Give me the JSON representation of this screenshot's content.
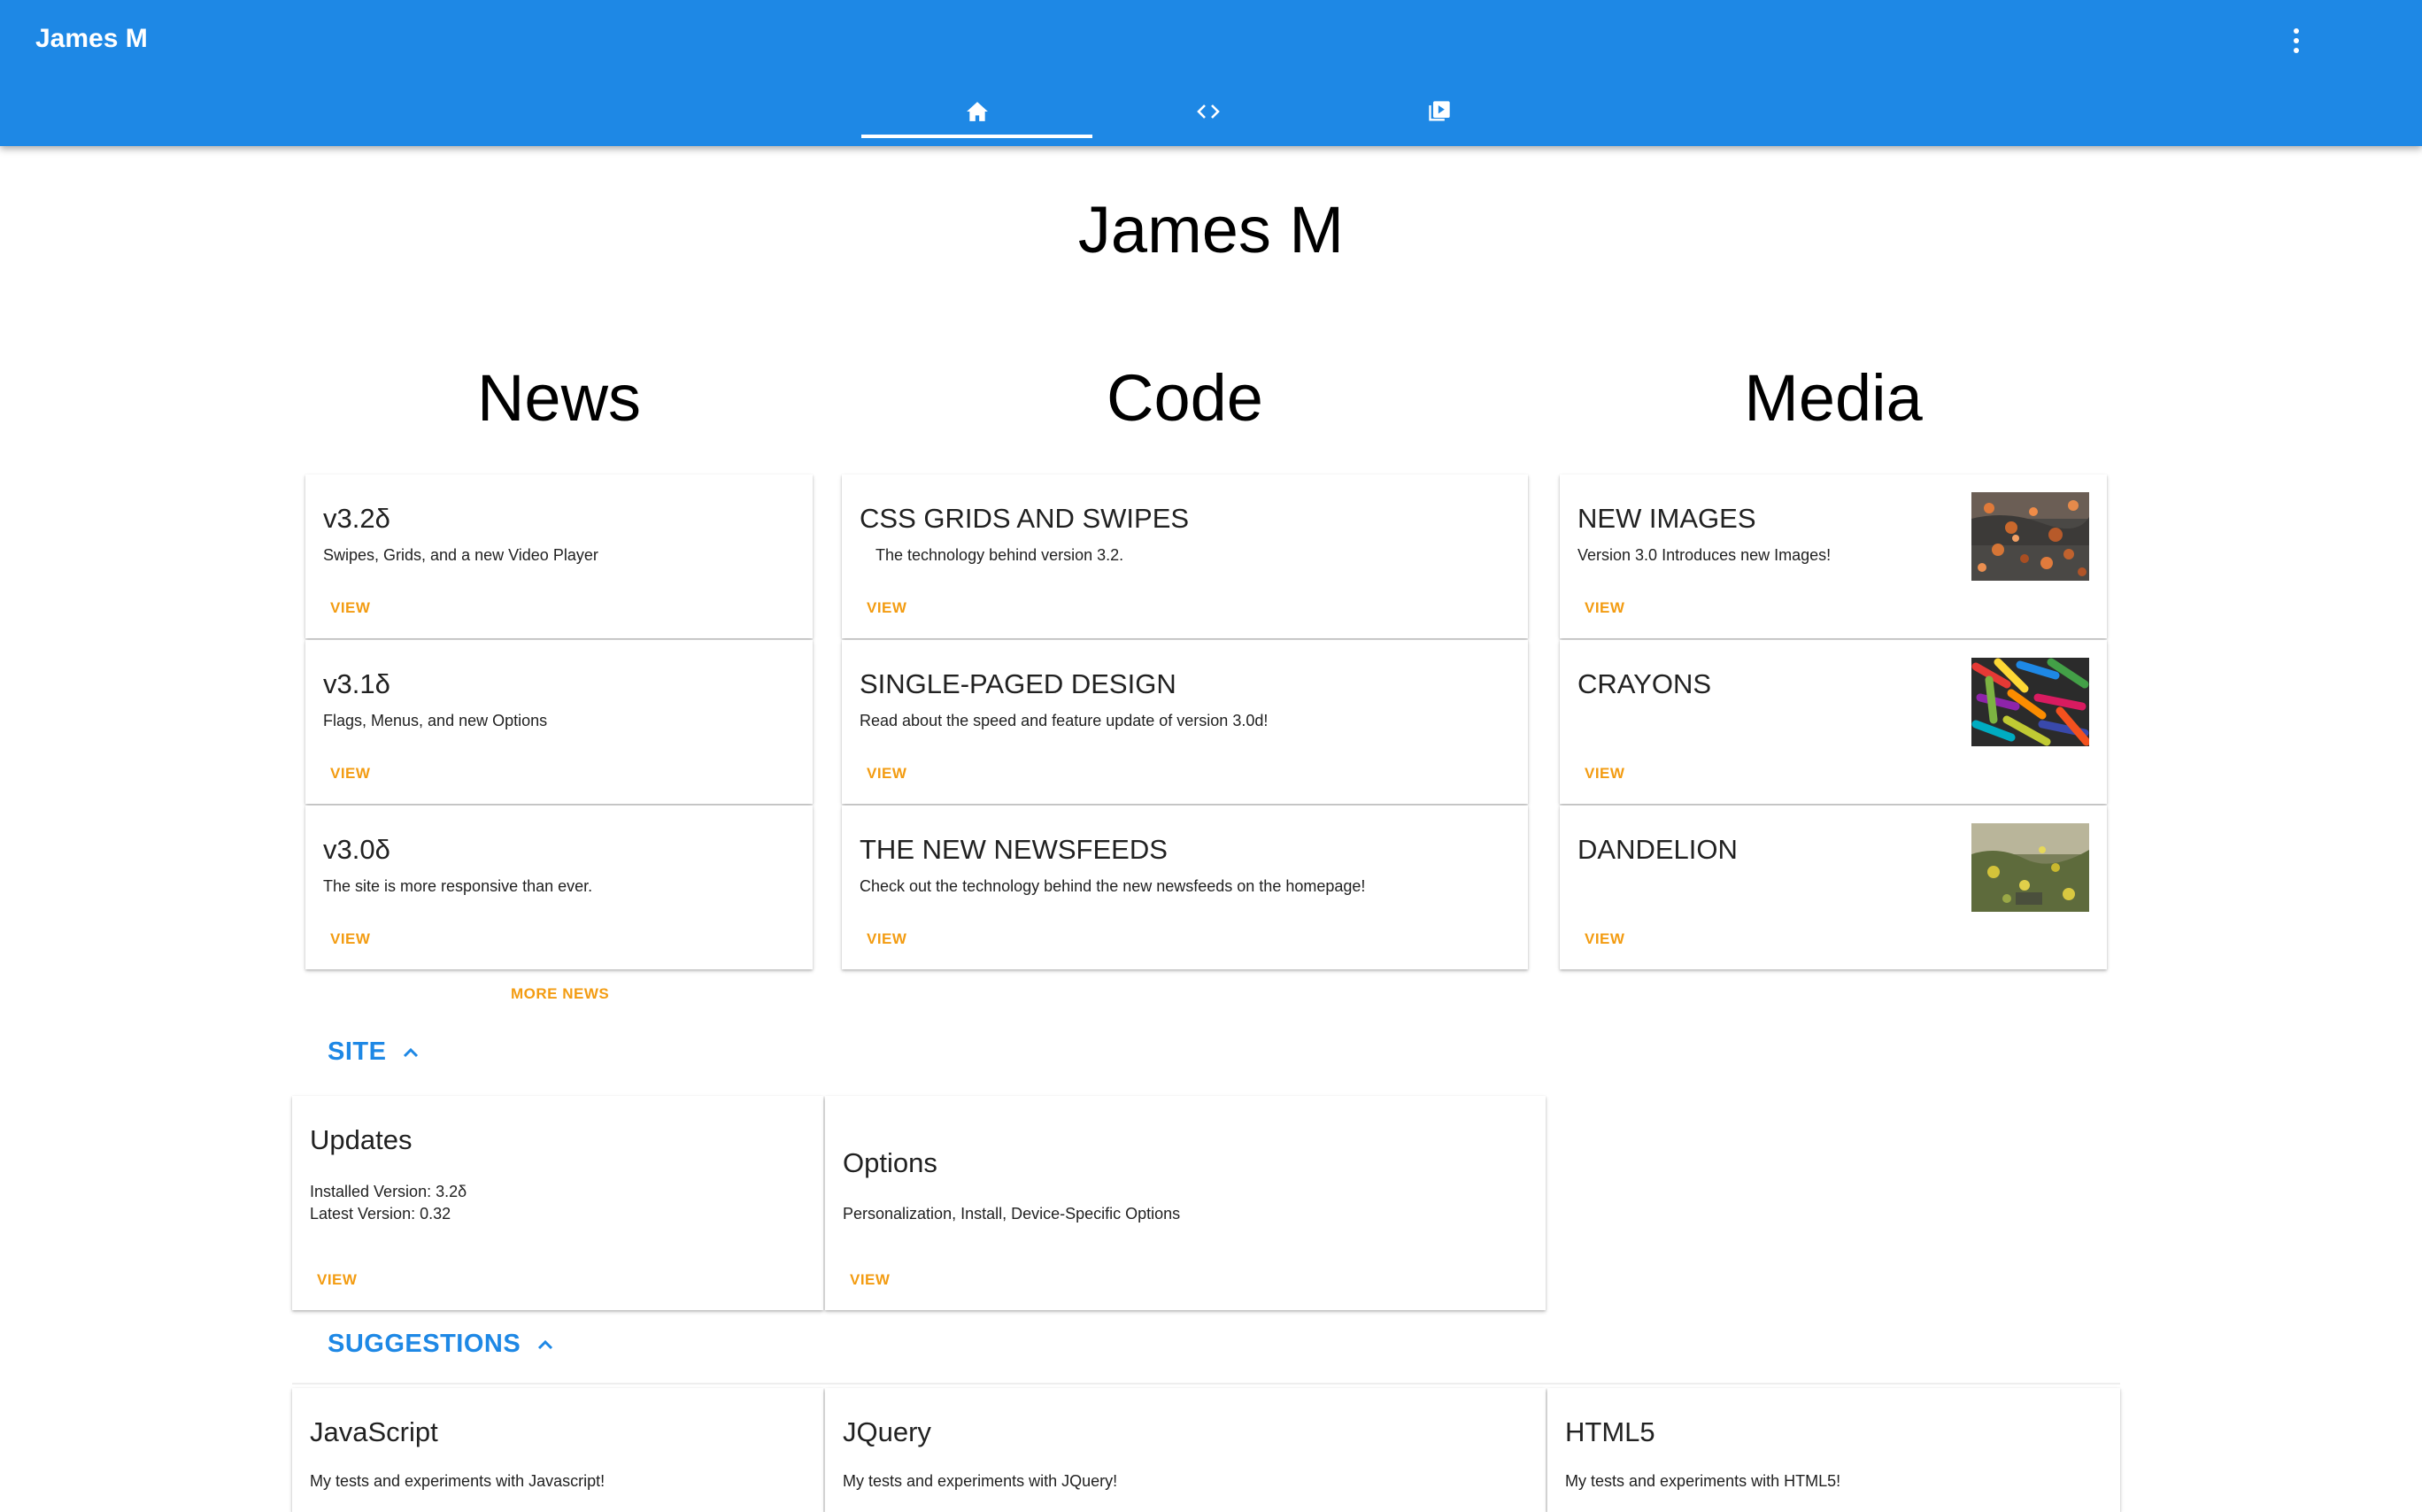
{
  "app": {
    "title": "James M"
  },
  "tabs": [
    {
      "icon": "home-icon",
      "active": true
    },
    {
      "icon": "code-icon",
      "active": false
    },
    {
      "icon": "video-library-icon",
      "active": false
    }
  ],
  "page": {
    "title": "James M"
  },
  "columns": {
    "news": {
      "title": "News",
      "cards": [
        {
          "title": "v3.2δ",
          "subtitle": "Swipes, Grids, and a new Video Player",
          "action": "VIEW"
        },
        {
          "title": "v3.1δ",
          "subtitle": "Flags, Menus, and new Options",
          "action": "VIEW"
        },
        {
          "title": "v3.0δ",
          "subtitle": "The site is more responsive than ever.",
          "action": "VIEW"
        }
      ],
      "more": "MORE NEWS"
    },
    "code": {
      "title": "Code",
      "cards": [
        {
          "title": "CSS GRIDS AND SWIPES",
          "subtitle": "The technology behind version 3.2.",
          "action": "VIEW"
        },
        {
          "title": "SINGLE-PAGED DESIGN",
          "subtitle": "Read about the speed and feature update of version 3.0d!",
          "action": "VIEW"
        },
        {
          "title": "THE NEW NEWSFEEDS",
          "subtitle": "Check out the technology behind the new newsfeeds on the homepage!",
          "action": "VIEW"
        }
      ]
    },
    "media": {
      "title": "Media",
      "cards": [
        {
          "title": "NEW IMAGES",
          "subtitle": "Version 3.0 Introduces new Images!",
          "action": "VIEW",
          "image": "autumn-leaves-photo"
        },
        {
          "title": "CRAYONS",
          "subtitle": "",
          "action": "VIEW",
          "image": "crayons-photo"
        },
        {
          "title": "DANDELION",
          "subtitle": "",
          "action": "VIEW",
          "image": "dandelion-photo"
        }
      ]
    }
  },
  "site": {
    "heading": "SITE",
    "updates": {
      "title": "Updates",
      "installed": "Installed Version: 3.2δ",
      "latest": "Latest Version: 0.32",
      "action": "VIEW"
    },
    "options": {
      "title": "Options",
      "text": "Personalization, Install, Device-Specific Options",
      "action": "VIEW"
    }
  },
  "suggestions": {
    "heading": "SUGGESTIONS",
    "cards": [
      {
        "title": "JavaScript",
        "text": "My tests and experiments with Javascript!"
      },
      {
        "title": "JQuery",
        "text": "My tests and experiments with JQuery!"
      },
      {
        "title": "HTML5",
        "text": "My tests and experiments with HTML5!"
      }
    ]
  },
  "colors": {
    "primary": "#1e88e5",
    "accent": "#f39c12"
  }
}
